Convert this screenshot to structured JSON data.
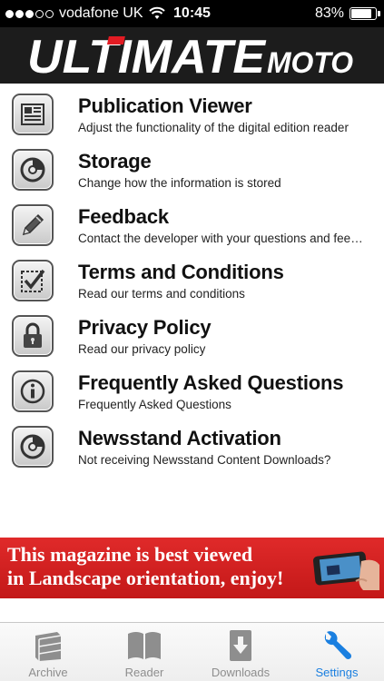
{
  "status_bar": {
    "carrier": "vodafone UK",
    "time": "10:45",
    "battery": "83%",
    "battery_level": 0.83,
    "signal_filled": 3,
    "signal_total": 5
  },
  "header": {
    "logo_main": "ULTIMATE",
    "logo_sub": "MOTO",
    "accent_color": "#e21b23"
  },
  "settings": {
    "items": [
      {
        "title": "Publication Viewer",
        "subtitle": "Adjust the functionality of the digital edition reader",
        "icon": "publication-viewer-icon"
      },
      {
        "title": "Storage",
        "subtitle": "Change how the information is stored",
        "icon": "storage-icon"
      },
      {
        "title": "Feedback",
        "subtitle": "Contact the developer with your questions and fee…",
        "icon": "pencil-icon"
      },
      {
        "title": "Terms and Conditions",
        "subtitle": "Read our terms and conditions",
        "icon": "checklist-icon"
      },
      {
        "title": "Privacy Policy",
        "subtitle": "Read our privacy policy",
        "icon": "lock-icon"
      },
      {
        "title": "Frequently Asked Questions",
        "subtitle": "Frequently Asked Questions",
        "icon": "info-icon"
      },
      {
        "title": "Newsstand Activation",
        "subtitle": "Not receiving Newsstand Content Downloads?",
        "icon": "newsstand-icon"
      }
    ]
  },
  "banner": {
    "line1": "This magazine is best viewed",
    "line2": "in Landscape orientation, enjoy!",
    "color": "#d22020"
  },
  "tab_bar": {
    "tabs": [
      {
        "label": "Archive",
        "icon": "archive-icon",
        "active": false
      },
      {
        "label": "Reader",
        "icon": "book-icon",
        "active": false
      },
      {
        "label": "Downloads",
        "icon": "download-icon",
        "active": false
      },
      {
        "label": "Settings",
        "icon": "wrench-icon",
        "active": true
      }
    ],
    "active_color": "#1a7fe0",
    "inactive_color": "#8e8e8e"
  }
}
